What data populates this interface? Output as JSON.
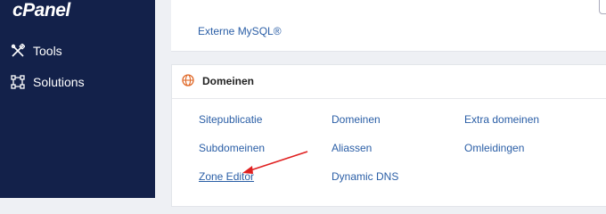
{
  "sidebar": {
    "logo": "cPanel",
    "items": [
      {
        "label": "Tools",
        "icon": "tools-icon"
      },
      {
        "label": "Solutions",
        "icon": "solutions-icon"
      }
    ]
  },
  "database_section": {
    "links": [
      "Externe MySQL®"
    ]
  },
  "domains_section": {
    "title": "Domeinen",
    "icon": "globe-icon",
    "links": [
      "Sitepublicatie",
      "Domeinen",
      "Extra domeinen",
      "Subdomeinen",
      "Aliassen",
      "Omleidingen",
      "Zone Editor",
      "Dynamic DNS"
    ]
  },
  "colors": {
    "sidebar_bg": "#13214a",
    "link": "#2a5ea6",
    "globe_icon": "#e06a2a",
    "annotation_arrow": "#e02020"
  },
  "annotation": {
    "type": "arrow",
    "points_to": "Zone Editor"
  }
}
